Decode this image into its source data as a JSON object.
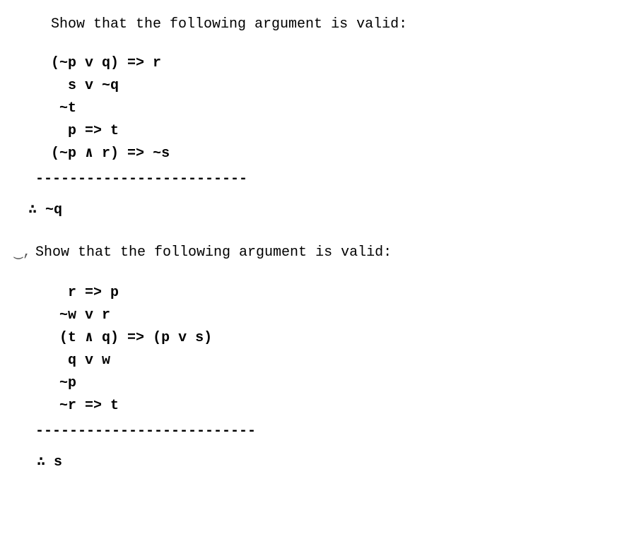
{
  "problem1": {
    "prompt": "Show that the following argument is valid:",
    "premises": [
      " (~p v q) => r",
      "   s v ~q",
      "  ~t",
      "   p => t",
      " (~p ∧ r) => ~s"
    ],
    "divider": "-------------------------",
    "conclusion": "∴ ~q"
  },
  "problem2": {
    "marker": "‿,",
    "prompt": "Show that the following argument is valid:",
    "premises": [
      "   r => p",
      "  ~w v r",
      "  (t ∧ q) => (p v s)",
      "   q v w",
      "  ~p",
      "  ~r => t"
    ],
    "divider": "--------------------------",
    "conclusion": " ∴ s"
  }
}
